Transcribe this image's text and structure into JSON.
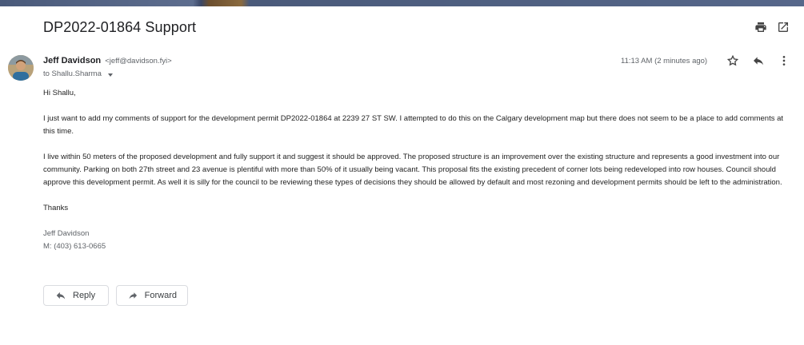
{
  "subject": "DP2022-01864 Support",
  "sender": {
    "name": "Jeff Davidson",
    "email": "<jeff@davidson.fyi>",
    "to": "to Shallu.Sharma"
  },
  "timestamp": "11:13 AM (2 minutes ago)",
  "icons": {
    "print": "print-icon",
    "popout": "open-in-new-icon",
    "star": "star-icon",
    "reply": "reply-icon",
    "more": "more-vertical-icon",
    "forward": "forward-icon"
  },
  "body": {
    "greeting": "Hi Shallu,",
    "paragraph1": "I just want to add my comments of support for the development permit DP2022-01864 at 2239 27 ST SW. I attempted to do this on the Calgary development map but there does not seem to be a place to add comments at this time.",
    "paragraph2": "I live within 50 meters of the proposed development and fully support it and suggest it should be approved. The proposed structure is an improvement over the existing structure and represents a good investment into our community. Parking on both 27th street and 23 avenue is plentiful with more than 50% of it usually being vacant. This proposal fits the existing precedent of corner lots being redeveloped into row houses. Council should approve this development permit. As well it is silly for the council to be reviewing these types of decisions they should be allowed by default and most rezoning and development permits should be left to the administration.",
    "closing": "Thanks",
    "signature_name": "Jeff Davidson",
    "signature_phone": "M: (403) 613-0665"
  },
  "actions": {
    "reply_label": "Reply",
    "forward_label": "Forward"
  },
  "colors": {
    "text": "#222222",
    "muted": "#5f6368",
    "border": "#dadce0"
  }
}
